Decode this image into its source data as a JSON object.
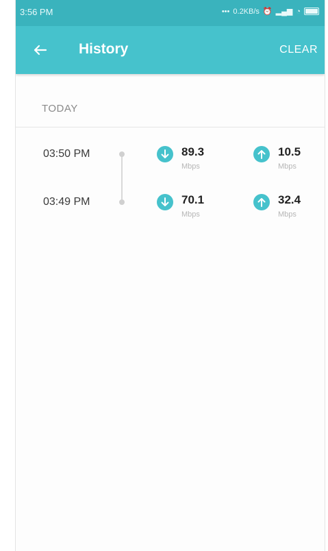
{
  "status_bar": {
    "time": "3:56 PM",
    "speed": "0.2KB/s"
  },
  "app_bar": {
    "title": "History",
    "clear_label": "CLEAR",
    "back_icon": "back-arrow-icon"
  },
  "section": {
    "label": "TODAY"
  },
  "entries": [
    {
      "time": "03:50 PM",
      "download": "89.3",
      "download_unit": "Mbps",
      "upload": "10.5",
      "upload_unit": "Mbps"
    },
    {
      "time": "03:49 PM",
      "download": "70.1",
      "download_unit": "Mbps",
      "upload": "32.4",
      "upload_unit": "Mbps"
    }
  ],
  "colors": {
    "status_bar": "#3ab3bd",
    "app_bar": "#46c2cc",
    "accent_icon": "#46c2cc"
  }
}
